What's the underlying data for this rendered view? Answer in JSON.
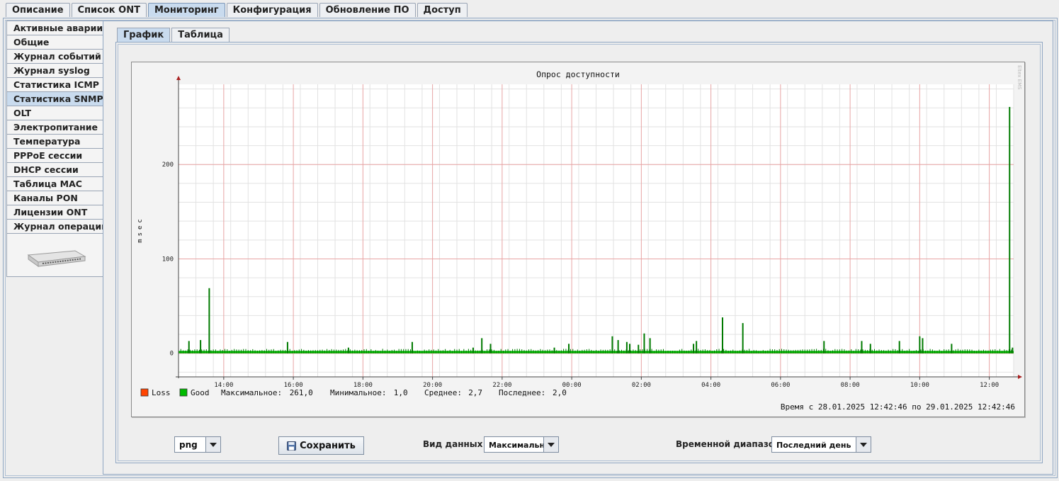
{
  "top_tabs": [
    "Описание",
    "Список ONT",
    "Мониторинг",
    "Конфигурация",
    "Обновление ПО",
    "Доступ"
  ],
  "top_tab_active": 2,
  "sidebar": {
    "items": [
      "Активные аварии",
      "Общие",
      "Журнал событий",
      "Журнал syslog",
      "Статистика ICMP",
      "Статистика SNMP",
      "OLT",
      "Электропитание",
      "Температура",
      "PPPoE сессии",
      "DHCP сессии",
      "Таблица MAC",
      "Каналы PON",
      "Лицензии ONT",
      "Журнал операций"
    ],
    "active": 5
  },
  "sub_tabs": [
    "График",
    "Таблица"
  ],
  "sub_tab_active": 0,
  "chart_data": {
    "type": "bar",
    "title": "Опрос доступности",
    "ylabel": "msec",
    "watermark": "Eltex EMS",
    "ylim": [
      -25,
      285
    ],
    "yticks": [
      0,
      100,
      200
    ],
    "xrange": [
      "12:42",
      "12:42"
    ],
    "xticks": [
      "14:00",
      "16:00",
      "18:00",
      "20:00",
      "22:00",
      "00:00",
      "02:00",
      "04:00",
      "06:00",
      "08:00",
      "10:00",
      "12:00"
    ],
    "legend": [
      "Loss",
      "Good"
    ],
    "series_colors": {
      "Loss": "#ff4400",
      "Good": "#00bb00",
      "bars": "#007a00"
    },
    "spikes": [
      {
        "t": "13:00",
        "v": 13
      },
      {
        "t": "13:20",
        "v": 14
      },
      {
        "t": "13:35",
        "v": 69
      },
      {
        "t": "15:50",
        "v": 12
      },
      {
        "t": "17:35",
        "v": 6
      },
      {
        "t": "19:25",
        "v": 12
      },
      {
        "t": "21:10",
        "v": 6
      },
      {
        "t": "21:25",
        "v": 16
      },
      {
        "t": "21:40",
        "v": 10
      },
      {
        "t": "23:30",
        "v": 6
      },
      {
        "t": "23:55",
        "v": 10
      },
      {
        "t": "01:10",
        "v": 18
      },
      {
        "t": "01:20",
        "v": 14
      },
      {
        "t": "01:35",
        "v": 12
      },
      {
        "t": "01:40",
        "v": 10
      },
      {
        "t": "01:55",
        "v": 9
      },
      {
        "t": "02:05",
        "v": 21
      },
      {
        "t": "02:15",
        "v": 16
      },
      {
        "t": "03:30",
        "v": 10
      },
      {
        "t": "03:35",
        "v": 13
      },
      {
        "t": "04:20",
        "v": 38
      },
      {
        "t": "04:55",
        "v": 32
      },
      {
        "t": "07:15",
        "v": 13
      },
      {
        "t": "08:20",
        "v": 13
      },
      {
        "t": "08:35",
        "v": 10
      },
      {
        "t": "09:25",
        "v": 13
      },
      {
        "t": "10:00",
        "v": 18
      },
      {
        "t": "10:05",
        "v": 16
      },
      {
        "t": "10:55",
        "v": 10
      },
      {
        "t": "12:35",
        "v": 261
      },
      {
        "t": "12:40",
        "v": 6
      }
    ],
    "stats": {
      "max_label": "Максимальное:",
      "max": "261,0",
      "min_label": "Минимальное:",
      "min": "1,0",
      "avg_label": "Среднее:",
      "avg": "2,7",
      "last_label": "Последнее:",
      "last": "2,0"
    },
    "time_range": "Время с 28.01.2025 12:42:46 по 29.01.2025 12:42:46"
  },
  "controls": {
    "format": "png",
    "save_label": "Сохранить",
    "data_type_label": "Вид данных",
    "data_type_value": "Максимальное",
    "range_label": "Временной диапазон",
    "range_value": "Последний день"
  }
}
